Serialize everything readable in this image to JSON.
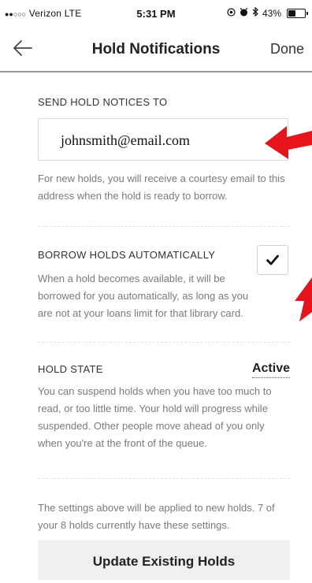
{
  "status_bar": {
    "carrier_dots": "●●○○○",
    "carrier": "Verizon  LTE",
    "time": "5:31 PM",
    "battery": "43%",
    "battery_level": 0.43
  },
  "nav": {
    "title": "Hold Notifications",
    "done_label": "Done"
  },
  "send_notices": {
    "label": "SEND HOLD NOTICES TO",
    "email_value": "johnsmith@email.com",
    "help_text": "For new holds, you will receive a courtesy email to this address when the hold is ready to borrow."
  },
  "borrow_auto": {
    "label": "BORROW HOLDS AUTOMATICALLY",
    "checked": true,
    "help_text": "When a hold becomes available, it will be borrowed for you automatically, as long as you are not at your loans limit for that library card."
  },
  "hold_state": {
    "label": "HOLD STATE",
    "value": "Active",
    "help_text": "You can suspend holds when you have too much to read, or too little time. Your hold will progress while suspended. Other people move ahead of you only when you're at the front of the queue."
  },
  "footer": {
    "note": "The settings above will be applied to new holds. 7 of your 8 holds currently have these settings.",
    "update_button_label": "Update Existing Holds"
  },
  "colors": {
    "annotation_arrow": "#e8141b",
    "divider": "#9a9a9a"
  }
}
